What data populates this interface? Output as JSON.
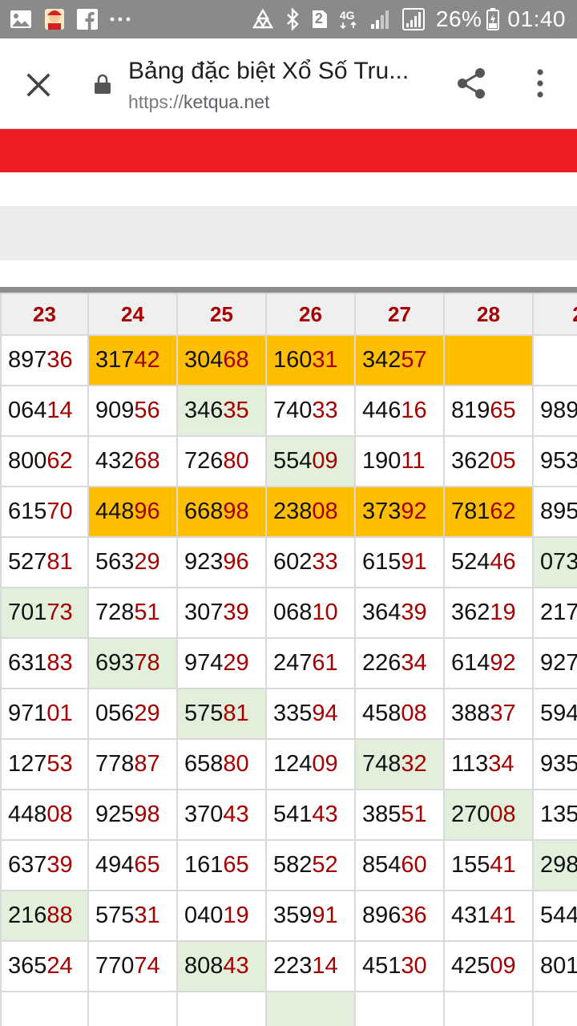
{
  "status_bar": {
    "icons": [
      "gallery-icon",
      "app-avatar-icon",
      "facebook-icon",
      "more-notifications-icon",
      "recycle-icon",
      "bluetooth-icon",
      "sim2-icon",
      "4g-icon",
      "signal-icon",
      "signal-icon-2",
      "battery-icon"
    ],
    "sim_label": "2",
    "network": "4G",
    "battery": "26%",
    "time": "01:40"
  },
  "browser": {
    "close_icon": "close-icon",
    "lock_icon": "lock-icon",
    "title": "Bảng đặc biệt Xổ Số Tru...",
    "url_protocol": "https://",
    "url_domain": "ketqua.net",
    "share_icon": "share-icon",
    "menu_icon": "more-vert-icon"
  },
  "colors": {
    "status_bar": "#8a8a8a",
    "red_band": "#ee1c25",
    "gray_band": "#ececec",
    "highlight_orange": "#ffbf00",
    "highlight_green": "#e1efdb",
    "header_text": "#a80000",
    "number_tail": "#a50000"
  },
  "table": {
    "headers": [
      "23",
      "24",
      "25",
      "26",
      "27",
      "28",
      "2"
    ],
    "rows": [
      {
        "cells": [
          {
            "head": "897",
            "tail": "36",
            "hl": ""
          },
          {
            "head": "317",
            "tail": "42",
            "hl": "orange"
          },
          {
            "head": "304",
            "tail": "68",
            "hl": "orange"
          },
          {
            "head": "160",
            "tail": "31",
            "hl": "orange"
          },
          {
            "head": "342",
            "tail": "57",
            "hl": "orange"
          },
          {
            "head": "",
            "tail": "",
            "hl": "orange"
          },
          {
            "head": "",
            "tail": "",
            "hl": ""
          }
        ]
      },
      {
        "cells": [
          {
            "head": "064",
            "tail": "14",
            "hl": ""
          },
          {
            "head": "909",
            "tail": "56",
            "hl": ""
          },
          {
            "head": "346",
            "tail": "35",
            "hl": "green"
          },
          {
            "head": "740",
            "tail": "33",
            "hl": ""
          },
          {
            "head": "446",
            "tail": "16",
            "hl": ""
          },
          {
            "head": "819",
            "tail": "65",
            "hl": ""
          },
          {
            "head": "989",
            "tail": "",
            "hl": ""
          }
        ]
      },
      {
        "cells": [
          {
            "head": "800",
            "tail": "62",
            "hl": ""
          },
          {
            "head": "432",
            "tail": "68",
            "hl": ""
          },
          {
            "head": "726",
            "tail": "80",
            "hl": ""
          },
          {
            "head": "554",
            "tail": "09",
            "hl": "green"
          },
          {
            "head": "190",
            "tail": "11",
            "hl": ""
          },
          {
            "head": "362",
            "tail": "05",
            "hl": ""
          },
          {
            "head": "953",
            "tail": "",
            "hl": ""
          }
        ]
      },
      {
        "cells": [
          {
            "head": "615",
            "tail": "70",
            "hl": ""
          },
          {
            "head": "448",
            "tail": "96",
            "hl": "orange"
          },
          {
            "head": "668",
            "tail": "98",
            "hl": "orange"
          },
          {
            "head": "238",
            "tail": "08",
            "hl": "orange"
          },
          {
            "head": "373",
            "tail": "92",
            "hl": "orange"
          },
          {
            "head": "781",
            "tail": "62",
            "hl": "orange"
          },
          {
            "head": "895",
            "tail": "",
            "hl": ""
          }
        ]
      },
      {
        "cells": [
          {
            "head": "527",
            "tail": "81",
            "hl": ""
          },
          {
            "head": "563",
            "tail": "29",
            "hl": ""
          },
          {
            "head": "923",
            "tail": "96",
            "hl": ""
          },
          {
            "head": "602",
            "tail": "33",
            "hl": ""
          },
          {
            "head": "615",
            "tail": "91",
            "hl": ""
          },
          {
            "head": "524",
            "tail": "46",
            "hl": ""
          },
          {
            "head": "073",
            "tail": "",
            "hl": "green"
          }
        ]
      },
      {
        "cells": [
          {
            "head": "701",
            "tail": "73",
            "hl": "green"
          },
          {
            "head": "728",
            "tail": "51",
            "hl": ""
          },
          {
            "head": "307",
            "tail": "39",
            "hl": ""
          },
          {
            "head": "068",
            "tail": "10",
            "hl": ""
          },
          {
            "head": "364",
            "tail": "39",
            "hl": ""
          },
          {
            "head": "362",
            "tail": "19",
            "hl": ""
          },
          {
            "head": "217",
            "tail": "",
            "hl": ""
          }
        ]
      },
      {
        "cells": [
          {
            "head": "631",
            "tail": "83",
            "hl": ""
          },
          {
            "head": "693",
            "tail": "78",
            "hl": "green"
          },
          {
            "head": "974",
            "tail": "29",
            "hl": ""
          },
          {
            "head": "247",
            "tail": "61",
            "hl": ""
          },
          {
            "head": "226",
            "tail": "34",
            "hl": ""
          },
          {
            "head": "614",
            "tail": "92",
            "hl": ""
          },
          {
            "head": "927",
            "tail": "",
            "hl": ""
          }
        ]
      },
      {
        "cells": [
          {
            "head": "971",
            "tail": "01",
            "hl": ""
          },
          {
            "head": "056",
            "tail": "29",
            "hl": ""
          },
          {
            "head": "575",
            "tail": "81",
            "hl": "green"
          },
          {
            "head": "335",
            "tail": "94",
            "hl": ""
          },
          {
            "head": "458",
            "tail": "08",
            "hl": ""
          },
          {
            "head": "388",
            "tail": "37",
            "hl": ""
          },
          {
            "head": "594",
            "tail": "",
            "hl": ""
          }
        ]
      },
      {
        "cells": [
          {
            "head": "127",
            "tail": "53",
            "hl": ""
          },
          {
            "head": "778",
            "tail": "87",
            "hl": ""
          },
          {
            "head": "658",
            "tail": "80",
            "hl": ""
          },
          {
            "head": "124",
            "tail": "09",
            "hl": ""
          },
          {
            "head": "748",
            "tail": "32",
            "hl": "green"
          },
          {
            "head": "113",
            "tail": "34",
            "hl": ""
          },
          {
            "head": "935",
            "tail": "",
            "hl": ""
          }
        ]
      },
      {
        "cells": [
          {
            "head": "448",
            "tail": "08",
            "hl": ""
          },
          {
            "head": "925",
            "tail": "98",
            "hl": ""
          },
          {
            "head": "370",
            "tail": "43",
            "hl": ""
          },
          {
            "head": "541",
            "tail": "43",
            "hl": ""
          },
          {
            "head": "385",
            "tail": "51",
            "hl": ""
          },
          {
            "head": "270",
            "tail": "08",
            "hl": "green"
          },
          {
            "head": "135",
            "tail": "",
            "hl": ""
          }
        ]
      },
      {
        "cells": [
          {
            "head": "637",
            "tail": "39",
            "hl": ""
          },
          {
            "head": "494",
            "tail": "65",
            "hl": ""
          },
          {
            "head": "161",
            "tail": "65",
            "hl": ""
          },
          {
            "head": "582",
            "tail": "52",
            "hl": ""
          },
          {
            "head": "854",
            "tail": "60",
            "hl": ""
          },
          {
            "head": "155",
            "tail": "41",
            "hl": ""
          },
          {
            "head": "298",
            "tail": "",
            "hl": "green"
          }
        ]
      },
      {
        "cells": [
          {
            "head": "216",
            "tail": "88",
            "hl": "green"
          },
          {
            "head": "575",
            "tail": "31",
            "hl": ""
          },
          {
            "head": "040",
            "tail": "19",
            "hl": ""
          },
          {
            "head": "359",
            "tail": "91",
            "hl": ""
          },
          {
            "head": "896",
            "tail": "36",
            "hl": ""
          },
          {
            "head": "431",
            "tail": "41",
            "hl": ""
          },
          {
            "head": "544",
            "tail": "",
            "hl": ""
          }
        ]
      },
      {
        "cells": [
          {
            "head": "365",
            "tail": "24",
            "hl": ""
          },
          {
            "head": "770",
            "tail": "74",
            "hl": ""
          },
          {
            "head": "808",
            "tail": "43",
            "hl": "green"
          },
          {
            "head": "223",
            "tail": "14",
            "hl": ""
          },
          {
            "head": "451",
            "tail": "30",
            "hl": ""
          },
          {
            "head": "425",
            "tail": "09",
            "hl": ""
          },
          {
            "head": "801",
            "tail": "",
            "hl": ""
          }
        ]
      },
      {
        "cells": [
          {
            "head": "",
            "tail": "",
            "hl": ""
          },
          {
            "head": "",
            "tail": "",
            "hl": ""
          },
          {
            "head": "",
            "tail": "",
            "hl": ""
          },
          {
            "head": "",
            "tail": "",
            "hl": "green"
          },
          {
            "head": "",
            "tail": "",
            "hl": ""
          },
          {
            "head": "",
            "tail": "",
            "hl": ""
          },
          {
            "head": "",
            "tail": "",
            "hl": ""
          }
        ]
      }
    ]
  }
}
